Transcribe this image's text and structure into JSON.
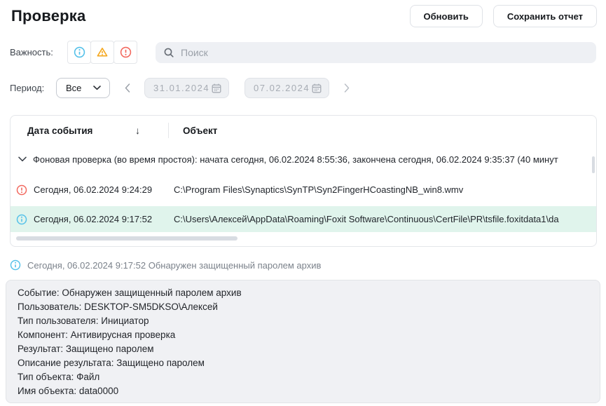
{
  "page": {
    "title": "Проверка"
  },
  "toolbar": {
    "refresh_label": "Обновить",
    "save_report_label": "Сохранить отчет"
  },
  "filters": {
    "importance_label": "Важность:",
    "severity_buttons": [
      "info",
      "warning",
      "critical"
    ],
    "search": {
      "placeholder": "Поиск"
    },
    "period_label": "Период:",
    "period_value": "Все",
    "date_from": "31.01.2024",
    "date_to": "07.02.2024"
  },
  "table": {
    "columns": [
      "Дата события",
      "Объект"
    ],
    "sort_icon": "↓",
    "group_row": "Фоновая проверка (во время простоя): начата сегодня, 06.02.2024 8:55:36, закончена сегодня, 06.02.2024 9:35:37 (40 минут",
    "rows": [
      {
        "severity": "critical",
        "date": "Сегодня, 06.02.2024 9:24:29",
        "object": "C:\\Program Files\\Synaptics\\SynTP\\Syn2FingerHCoastingNB_win8.wmv",
        "selected": false
      },
      {
        "severity": "info",
        "date": "Сегодня, 06.02.2024 9:17:52",
        "object": "C:\\Users\\Алексей\\AppData\\Roaming\\Foxit Software\\Continuous\\CertFile\\PR\\tsfile.foxitdata1\\da",
        "selected": true
      }
    ]
  },
  "detail": {
    "header": "Сегодня, 06.02.2024 9:17:52 Обнаружен защищенный паролем архив",
    "lines": [
      "Событие: Обнаружен защищенный паролем архив",
      "Пользователь: DESKTOP-SM5DKSO\\Алексей",
      "Тип пользователя: Инициатор",
      "Компонент: Антивирусная проверка",
      "Результат: Защищено паролем",
      "Описание результата: Защищено паролем",
      "Тип объекта: Файл",
      "Имя объекта: data0000"
    ]
  },
  "colors": {
    "severity_info": "#55c1e9",
    "severity_warning": "#f5a71e",
    "severity_critical": "#f2695f",
    "selected_row_bg": "#e0f4ec",
    "field_bg": "#eef0f4",
    "border": "#e4e6ea"
  }
}
